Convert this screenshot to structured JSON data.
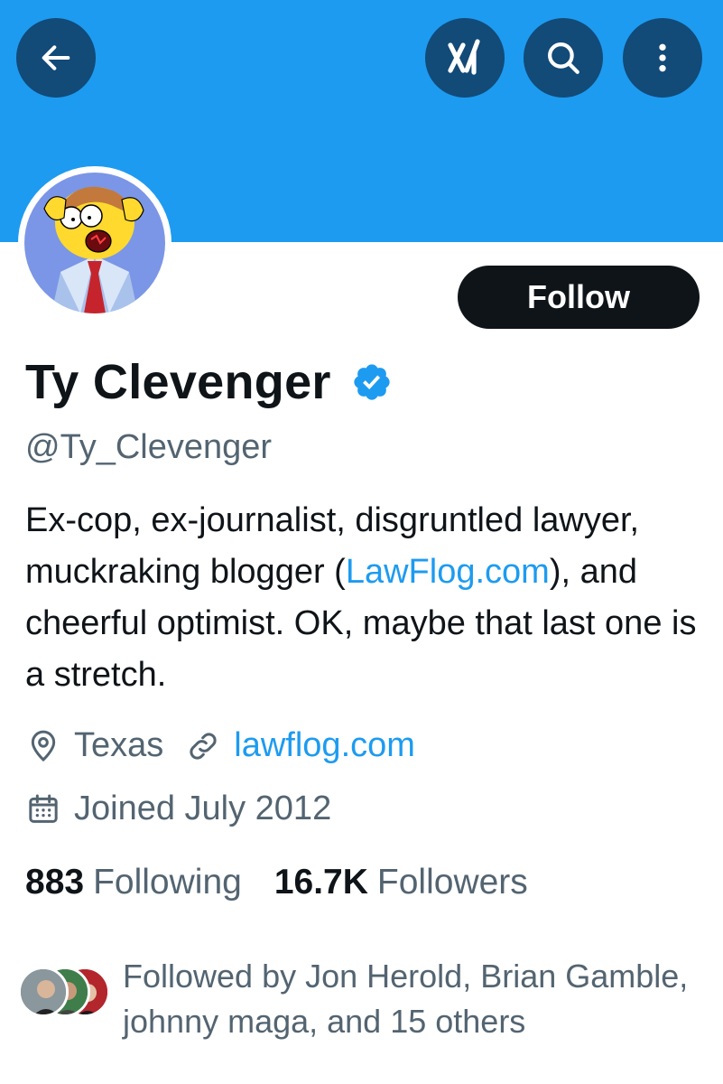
{
  "header": {
    "back_icon": "arrow-left-icon",
    "grok_icon": "grok-icon",
    "search_icon": "search-icon",
    "more_icon": "more-vertical-icon",
    "banner_color": "#1d9bf0",
    "button_color": "#124a78"
  },
  "profile": {
    "display_name": "Ty Clevenger",
    "verified": true,
    "handle": "@Ty_Clevenger",
    "follow_label": "Follow",
    "bio_part1": "Ex-cop, ex-journalist, disgruntled lawyer, muckraking blogger (",
    "bio_link": "LawFlog.com",
    "bio_part2": "), and cheerful optimist. OK, maybe that last one is a stretch.",
    "location": "Texas",
    "website": "lawflog.com",
    "joined": "Joined July 2012"
  },
  "stats": {
    "following_count": "883",
    "following_label": "Following",
    "followers_count": "16.7K",
    "followers_label": "Followers"
  },
  "followed_by": {
    "text": "Followed by Jon Herold, Brian Gamble, johnny maga, and 15 others"
  },
  "colors": {
    "accent": "#1d9bf0",
    "text": "#0f1419",
    "secondary": "#536471"
  }
}
